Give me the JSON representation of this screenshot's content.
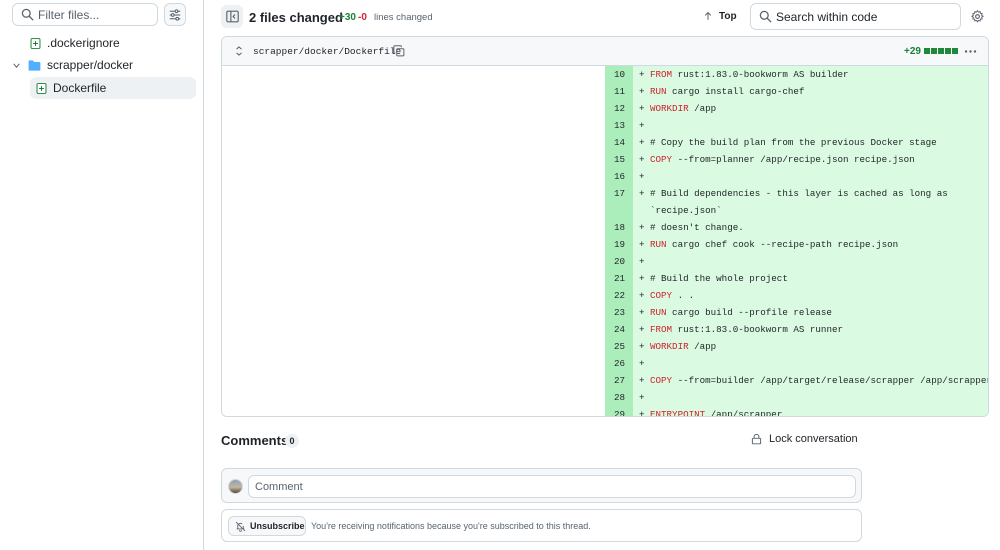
{
  "tree": {
    "filter_placeholder": "Filter files...",
    "items": [
      {
        "label": ".dockerignore",
        "icon": "file-added-icon"
      },
      {
        "label": "scrapper/docker",
        "icon": "folder-icon"
      },
      {
        "label": "Dockerfile",
        "icon": "file-added-icon"
      }
    ]
  },
  "header": {
    "files_changed": "2 files changed",
    "additions": "+30",
    "deletions": "-0",
    "lines_changed": "lines changed",
    "top_label": "Top",
    "search_placeholder": "Search within code"
  },
  "diff": {
    "file_path": "scrapper/docker/Dockerfile",
    "file_additions": "+29",
    "colors": {
      "added_gutter": "#aceebb",
      "added_code": "#dafbe1",
      "keyword": "#cf222e",
      "accent_green": "#1a7f37"
    },
    "lines": [
      {
        "num": "10",
        "kw": "FROM",
        "rest": " rust:1.83.0-bookworm AS builder"
      },
      {
        "num": "11",
        "kw": "RUN",
        "rest": " cargo install cargo-chef"
      },
      {
        "num": "12",
        "kw": "WORKDIR",
        "rest": " /app"
      },
      {
        "num": "13",
        "kw": "",
        "rest": ""
      },
      {
        "num": "14",
        "kw": "",
        "rest": "# Copy the build plan from the previous Docker stage"
      },
      {
        "num": "15",
        "kw": "COPY",
        "rest": " --from=planner /app/recipe.json recipe.json"
      },
      {
        "num": "16",
        "kw": "",
        "rest": ""
      },
      {
        "num": "17",
        "kw": "",
        "rest": "# Build dependencies - this layer is cached as long as"
      },
      {
        "num": "",
        "kw": "",
        "rest": "`recipe.json`"
      },
      {
        "num": "18",
        "kw": "",
        "rest": "# doesn't change."
      },
      {
        "num": "19",
        "kw": "RUN",
        "rest": " cargo chef cook --recipe-path recipe.json"
      },
      {
        "num": "20",
        "kw": "",
        "rest": ""
      },
      {
        "num": "21",
        "kw": "",
        "rest": "# Build the whole project"
      },
      {
        "num": "22",
        "kw": "COPY",
        "rest": " . ."
      },
      {
        "num": "23",
        "kw": "RUN",
        "rest": " cargo build --profile release"
      },
      {
        "num": "24",
        "kw": "FROM",
        "rest": " rust:1.83.0-bookworm AS runner"
      },
      {
        "num": "25",
        "kw": "WORKDIR",
        "rest": " /app"
      },
      {
        "num": "26",
        "kw": "",
        "rest": ""
      },
      {
        "num": "27",
        "kw": "COPY",
        "rest": " --from=builder /app/target/release/scrapper /app/scrapper"
      },
      {
        "num": "28",
        "kw": "",
        "rest": ""
      },
      {
        "num": "29",
        "kw": "ENTRYPOINT",
        "rest": " /app/scrapper"
      }
    ]
  },
  "comments": {
    "title": "Comments",
    "count": "0",
    "lock_label": "Lock conversation",
    "comment_placeholder": "Comment",
    "unsubscribe_label": "Unsubscribe",
    "notification_text": "You're receiving notifications because you're subscribed to this thread."
  }
}
